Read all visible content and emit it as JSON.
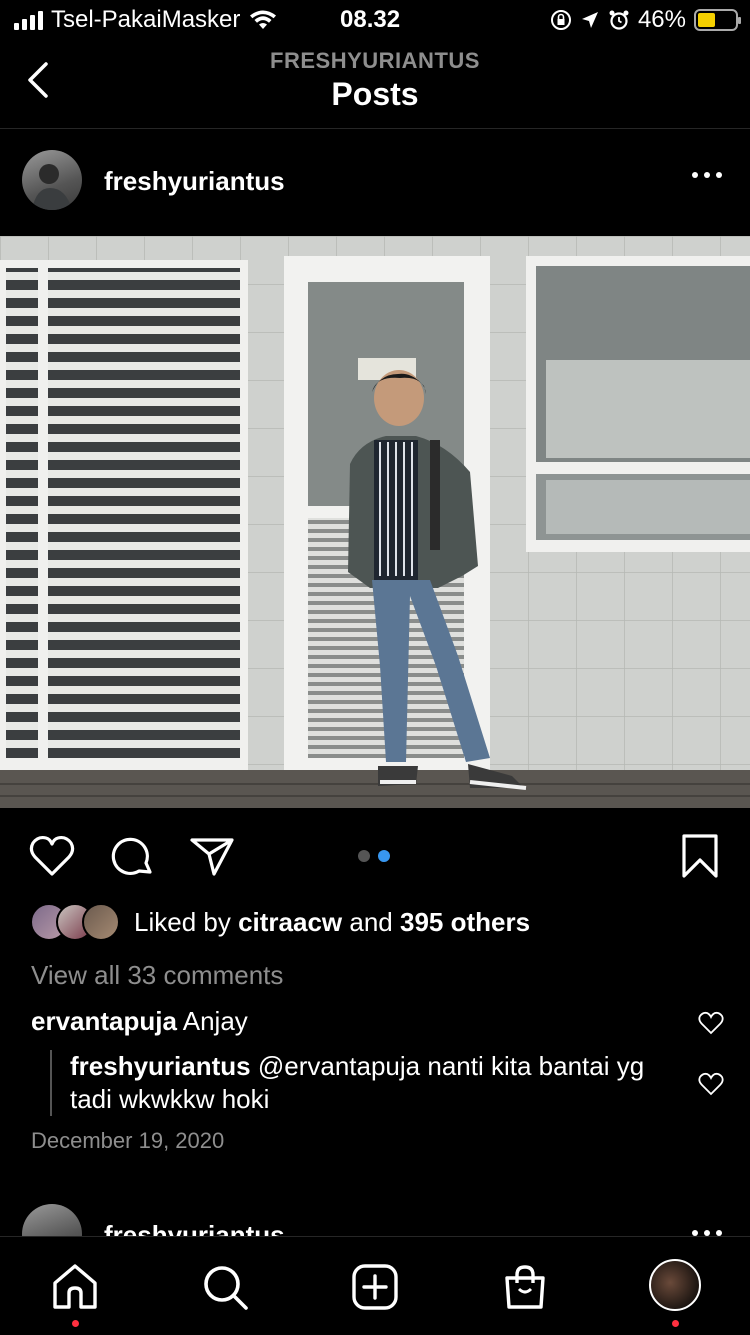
{
  "status_bar": {
    "carrier": "Tsel-PakaiMasker",
    "time": "08.32",
    "battery": "46%"
  },
  "header": {
    "subtitle": "FRESHYURIANTUS",
    "title": "Posts"
  },
  "post": {
    "username": "freshyuriantus",
    "liked_by_prefix": "Liked by",
    "liked_by_user": "citraacw",
    "liked_by_and": "and",
    "liked_by_others": "395 others",
    "view_all_comments": "View all 33 comments",
    "comments": [
      {
        "user": "ervantapuja",
        "text": "Anjay"
      }
    ],
    "reply": {
      "user": "freshyuriantus",
      "mention": "@ervantapuja",
      "text": "nanti kita bantai yg tadi wkwkkw hoki"
    },
    "date": "December 19, 2020",
    "carousel": {
      "count": 2,
      "active_index": 1
    }
  },
  "next_post": {
    "username": "freshyuriantus"
  },
  "tabs": [
    "home-icon",
    "search-icon",
    "new-post-icon",
    "shop-icon",
    "profile-avatar"
  ],
  "colors": {
    "accent": "#3897f0",
    "notification": "#ff3040",
    "battery": "#f5d000"
  }
}
